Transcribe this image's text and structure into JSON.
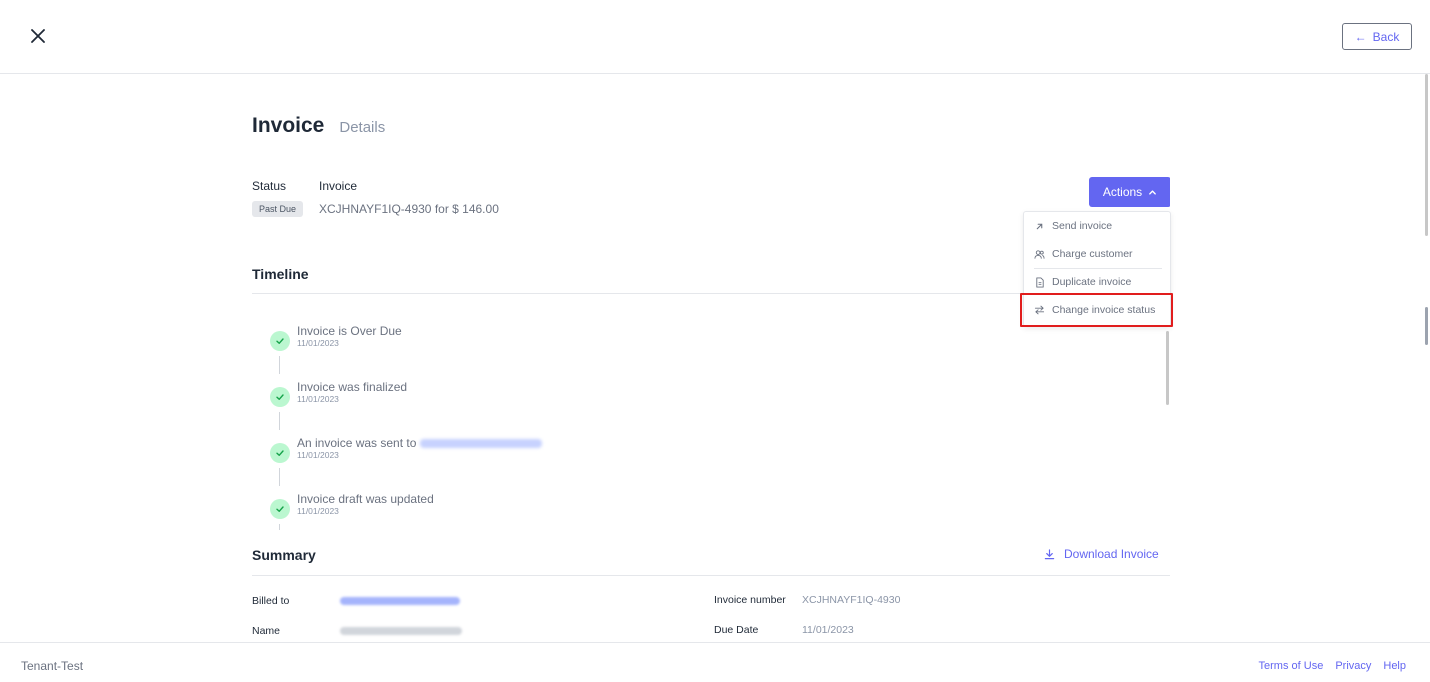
{
  "header": {
    "close_icon": "close-icon",
    "back_label": "Back",
    "back_icon": "arrow-left-icon"
  },
  "page": {
    "title": "Invoice",
    "subtitle": "Details"
  },
  "status": {
    "label": "Status",
    "badge": "Past Due",
    "invoice_label": "Invoice",
    "invoice_summary": "XCJHNAYF1IQ-4930 for $ 146.00"
  },
  "actions": {
    "label": "Actions",
    "icon": "chevron-up-icon",
    "color": "#6366f1",
    "menu": [
      {
        "label": "Send invoice",
        "icon": "arrow-up-right-icon"
      },
      {
        "label": "Charge customer",
        "icon": "users-icon"
      },
      {
        "label": "Duplicate invoice",
        "icon": "document-icon"
      },
      {
        "label": "Change invoice status",
        "icon": "arrows-swap-icon"
      }
    ]
  },
  "timeline": {
    "title": "Timeline",
    "items": [
      {
        "text": "Invoice is Over Due",
        "date": "11/01/2023"
      },
      {
        "text": "Invoice was finalized",
        "date": "11/01/2023"
      },
      {
        "text": "An invoice was sent to",
        "date": "11/01/2023"
      },
      {
        "text": "Invoice draft was updated",
        "date": "11/01/2023"
      }
    ]
  },
  "summary": {
    "title": "Summary",
    "download_label": "Download Invoice",
    "download_icon": "download-icon",
    "billed_to_label": "Billed to",
    "name_label": "Name",
    "invoice_number_label": "Invoice number",
    "invoice_number": "XCJHNAYF1IQ-4930",
    "due_date_label": "Due Date",
    "due_date": "11/01/2023"
  },
  "footer": {
    "tenant": "Tenant-Test",
    "links": [
      "Terms of Use",
      "Privacy",
      "Help"
    ]
  }
}
